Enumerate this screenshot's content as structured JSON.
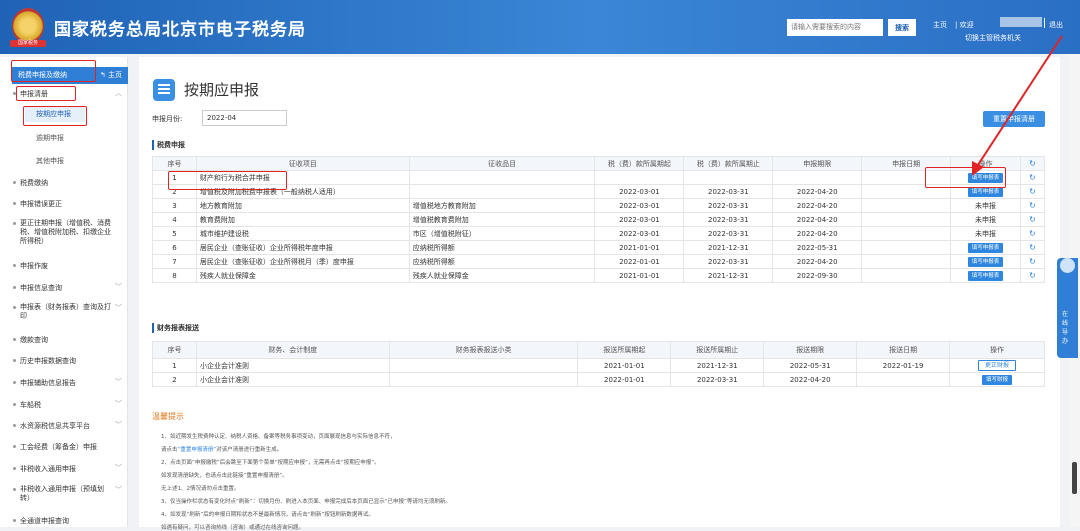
{
  "header": {
    "title": "国家税务总局北京市电子税务局",
    "logo_text": "国家税务",
    "search_placeholder": "请输入需要搜索的内容",
    "search_button": "搜索",
    "home_link": "主页",
    "welcome": "| 欢迎",
    "switch_subject": "切换主管税务机关",
    "logout": "退出"
  },
  "sidebar": {
    "section_title": "税费申报及缴纳",
    "home_button": "主页",
    "items": [
      {
        "label": "申报清册"
      },
      {
        "label": "税费缴纳"
      },
      {
        "label": "申报错误更正"
      },
      {
        "label": "更正往期申报（增值税、消费税、增值税附加税、扣缴企业所得税）"
      },
      {
        "label": "申报作废"
      },
      {
        "label": "申报信息查询"
      },
      {
        "label": "申报表（财务报表）查询及打印"
      },
      {
        "label": "缴款查询"
      },
      {
        "label": "历史申报数据查询"
      },
      {
        "label": "申报辅助信息报告"
      },
      {
        "label": "车船税"
      },
      {
        "label": "水资源税信息共享平台"
      },
      {
        "label": "工会经费（筹备金）申报"
      },
      {
        "label": "非税收入通用申报"
      },
      {
        "label": "非税收入通用申报（预填划转）"
      },
      {
        "label": "全通道申报查询"
      }
    ],
    "subitems": [
      {
        "label": "按期应申报"
      },
      {
        "label": "逾期申报"
      },
      {
        "label": "其他申报"
      }
    ]
  },
  "page": {
    "title": "按期应申报",
    "month_label": "申报月份:",
    "month_value": "2022-04",
    "reset_button": "重置申报清册"
  },
  "tax_section": {
    "title": "税费申报",
    "headers": [
      "序号",
      "征收项目",
      "征收品目",
      "税（费）款所属期起",
      "税（费）款所属期止",
      "申报期限",
      "申报日期",
      "操作"
    ],
    "rows": [
      {
        "no": "1",
        "item": "财产和行为税合并申报",
        "sub": "",
        "start": "",
        "end": "",
        "deadline": "",
        "date": "",
        "action": "填写申报表",
        "action_type": "button"
      },
      {
        "no": "2",
        "item": "增值税及附加税费申报表（一般纳税人适用）",
        "sub": "",
        "start": "2022-03-01",
        "end": "2022-03-31",
        "deadline": "2022-04-20",
        "date": "",
        "action": "填写申报表",
        "action_type": "button"
      },
      {
        "no": "3",
        "item": "地方教育附加",
        "sub": "增值税地方教育附加",
        "start": "2022-03-01",
        "end": "2022-03-31",
        "deadline": "2022-04-20",
        "date": "",
        "action": "未申报",
        "action_type": "text"
      },
      {
        "no": "4",
        "item": "教育费附加",
        "sub": "增值税教育费附加",
        "start": "2022-03-01",
        "end": "2022-03-31",
        "deadline": "2022-04-20",
        "date": "",
        "action": "未申报",
        "action_type": "text"
      },
      {
        "no": "5",
        "item": "城市维护建设税",
        "sub": "市区（增值税附征）",
        "start": "2022-03-01",
        "end": "2022-03-31",
        "deadline": "2022-04-20",
        "date": "",
        "action": "未申报",
        "action_type": "text"
      },
      {
        "no": "6",
        "item": "居民企业（查账征收）企业所得税年度申报",
        "sub": "应纳税所得额",
        "start": "2021-01-01",
        "end": "2021-12-31",
        "deadline": "2022-05-31",
        "date": "",
        "action": "填写申报表",
        "action_type": "button"
      },
      {
        "no": "7",
        "item": "居民企业（查账征收）企业所得税月（季）度申报",
        "sub": "应纳税所得额",
        "start": "2022-01-01",
        "end": "2022-03-31",
        "deadline": "2022-04-20",
        "date": "",
        "action": "填写申报表",
        "action_type": "button"
      },
      {
        "no": "8",
        "item": "残疾人就业保障金",
        "sub": "残疾人就业保障金",
        "start": "2021-01-01",
        "end": "2021-12-31",
        "deadline": "2022-09-30",
        "date": "",
        "action": "填写申报表",
        "action_type": "button"
      }
    ]
  },
  "fin_section": {
    "title": "财务报表报送",
    "headers": [
      "序号",
      "财务、会计制度",
      "财务报表报送小类",
      "报送所属期起",
      "报送所属期止",
      "报送期限",
      "报送日期",
      "操作"
    ],
    "rows": [
      {
        "no": "1",
        "system": "小企业会计准则",
        "sub": "",
        "start": "2021-01-01",
        "end": "2021-12-31",
        "deadline": "2022-05-31",
        "date": "2022-01-19",
        "action": "更正财报",
        "action_type": "outline"
      },
      {
        "no": "2",
        "system": "小企业会计准则",
        "sub": "",
        "start": "2022-01-01",
        "end": "2022-03-31",
        "deadline": "2022-04-20",
        "date": "",
        "action": "填写财报",
        "action_type": "button"
      }
    ]
  },
  "tips": {
    "title": "温馨提示",
    "lines": [
      "1、如近期发生税费种认定、纳税人资格、备案等税务事项变动，页面展现信息与实际信息不符，",
      "请点击",
      "2、点击页面“申报缴税”后会跳至下面第个菜单“按期应申报”，无需再点击“按期应申报”。",
      "如发现清册缺失，也请点击此链接“重置申报清册”。",
      "无上述1、2情况请勿点击重置。",
      "3、仅当操作栏状态有变化时点“刷新”：切换月份、刷进入本页面、申报完成后本页面已显示“已申报”等请均无须刷新。",
      "4、如发现“刷新”后的申报日期和状态不是最新情况，请点击“刷新”按钮刷新数据再试。",
      "如遇有疑问，可以咨询热线（咨询）或通过在线咨询问题。"
    ],
    "link": "“重置申报清册”",
    "link_suffix": "对该户清册进行重新生成。"
  },
  "float_service": {
    "label": "在线导办"
  }
}
